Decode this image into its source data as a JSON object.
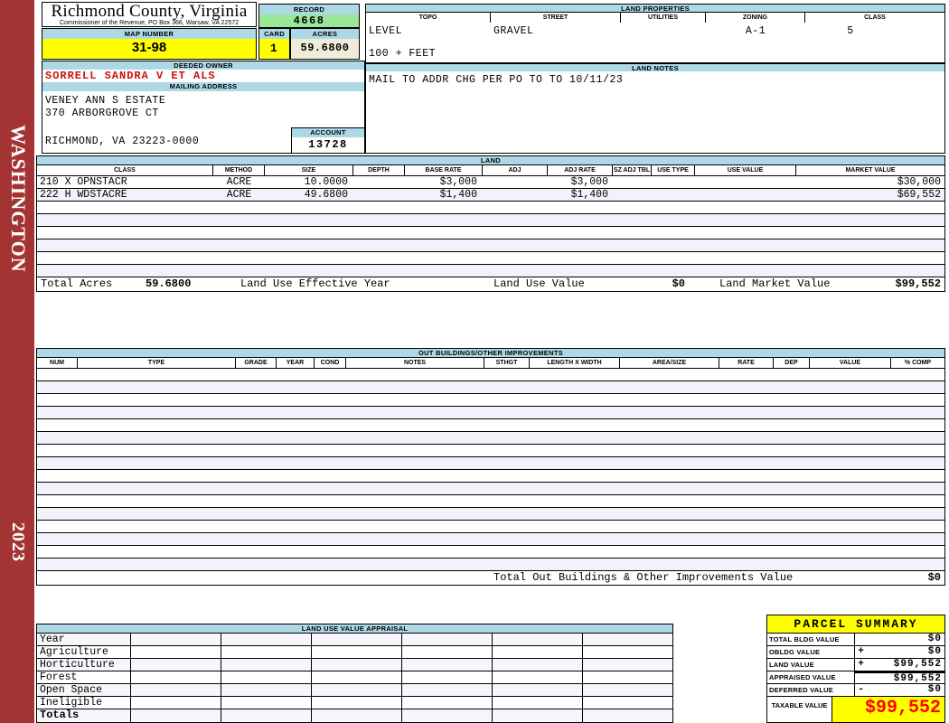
{
  "sidebar": {
    "county_watermark": "WASHINGTON",
    "year": "2023"
  },
  "header": {
    "title": "Richmond County, Virginia",
    "subtitle": "Commissioner of the Revenue, PO Box 366, Warsaw, VA 22572",
    "record_label": "RECORD",
    "record_value": "4668",
    "map_number_label": "MAP NUMBER",
    "map_number_value": "31-98",
    "card_label": "CARD",
    "card_value": "1",
    "acres_label": "ACRES",
    "acres_value": "59.6800"
  },
  "owner": {
    "deeded_owner_label": "DEEDED OWNER",
    "deeded_owner": "SORRELL SANDRA V ET ALS",
    "mailing_address_label": "MAILING ADDRESS",
    "address_line1": "VENEY ANN S ESTATE",
    "address_line2": "370 ARBORGROVE CT",
    "address_line3": "RICHMOND, VA 23223-0000",
    "account_label": "ACCOUNT",
    "account_value": "13728"
  },
  "land_properties": {
    "section_label": "LAND PROPERTIES",
    "headers": [
      "TOPO",
      "STREET",
      "UTILITIES",
      "ZONING",
      "CLASS"
    ],
    "values": {
      "topo": "LEVEL",
      "street": "GRAVEL",
      "utilities": "",
      "zoning": "A-1",
      "class": "5"
    },
    "frontage_note": "100 + FEET"
  },
  "land_notes": {
    "section_label": "LAND NOTES",
    "note": "MAIL TO ADDR CHG PER PO TO TO 10/11/23"
  },
  "land": {
    "section_label": "LAND",
    "headers": [
      "CLASS",
      "METHOD",
      "SIZE",
      "DEPTH",
      "BASE RATE",
      "ADJ",
      "ADJ RATE",
      "SZ ADJ TBL",
      "USE TYPE",
      "USE VALUE",
      "MARKET VALUE"
    ],
    "rows": [
      {
        "class": "210 X OPNSTACR",
        "method": "ACRE",
        "size": "10.0000",
        "depth": "",
        "base_rate": "$3,000",
        "adj": "",
        "adj_rate": "$3,000",
        "sz_adj_tbl": "",
        "use_type": "",
        "use_value": "",
        "market_value": "$30,000"
      },
      {
        "class": "222 H WDSTACRE",
        "method": "ACRE",
        "size": "49.6800",
        "depth": "",
        "base_rate": "$1,400",
        "adj": "",
        "adj_rate": "$1,400",
        "sz_adj_tbl": "",
        "use_type": "",
        "use_value": "",
        "market_value": "$69,552"
      }
    ],
    "totals": {
      "total_acres_label": "Total Acres",
      "total_acres": "59.6800",
      "land_use_effective_year_label": "Land Use Effective Year",
      "land_use_value_label": "Land Use Value",
      "land_use_value": "$0",
      "land_market_value_label": "Land Market Value",
      "land_market_value": "$99,552"
    }
  },
  "out_buildings": {
    "section_label": "OUT BUILDINGS/OTHER IMPROVEMENTS",
    "headers": [
      "NUM",
      "TYPE",
      "GRADE",
      "YEAR",
      "COND",
      "NOTES",
      "STHGT",
      "LENGTH X WIDTH",
      "AREA/SIZE",
      "RATE",
      "DEP",
      "VALUE",
      "% COMP"
    ],
    "total_label": "Total Out Buildings & Other Improvements Value",
    "total_value": "$0"
  },
  "land_use_appraisal": {
    "section_label": "LAND USE VALUE APPRAISAL",
    "row_labels": [
      "Year",
      "Agriculture",
      "Horticulture",
      "Forest",
      "Open Space",
      "Ineligible",
      "Totals"
    ]
  },
  "parcel_summary": {
    "title": "PARCEL SUMMARY",
    "rows": [
      {
        "label": "TOTAL BLDG VALUE",
        "operator": "",
        "value": "$0"
      },
      {
        "label": "OBLDG VALUE",
        "operator": "+",
        "value": "$0"
      },
      {
        "label": "LAND VALUE",
        "operator": "+",
        "value": "$99,552"
      },
      {
        "label": "APPRAISED VALUE",
        "operator": "",
        "value": "$99,552"
      },
      {
        "label": "DEFERRED VALUE",
        "operator": "-",
        "value": "$0"
      }
    ],
    "taxable_label": "TAXABLE VALUE",
    "taxable_value": "$99,552"
  },
  "colors": {
    "section_header_bg": "#ADD8E6",
    "highlight_yellow": "#FFFF00",
    "record_green": "#9AE79A",
    "acres_cream": "#EFEDD9",
    "sidebar_red": "#A43434",
    "owner_red": "#CC1111",
    "taxable_red": "#FF0000",
    "alt_row": "#F2F2FA"
  }
}
